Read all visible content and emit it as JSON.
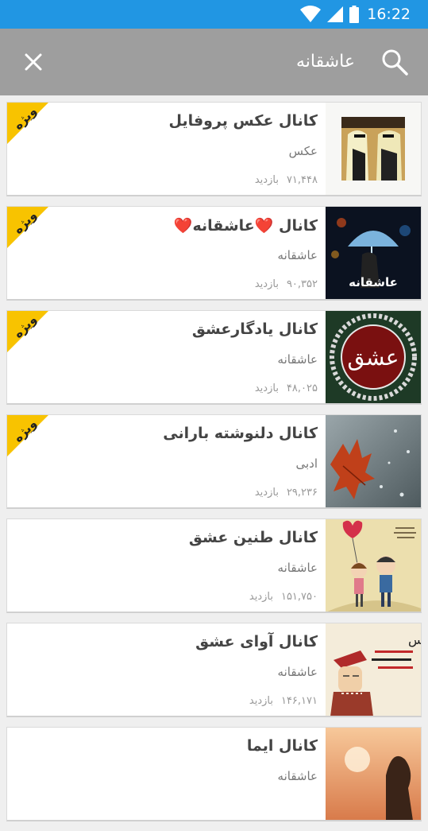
{
  "status_bar": {
    "time": "16:22"
  },
  "search": {
    "query": "عاشقانه"
  },
  "badge_label": "ویژه",
  "views_label": "بازدید",
  "channels": [
    {
      "title": "کانال عکس پروفایل",
      "category": "عکس",
      "views": "۷۱,۴۴۸",
      "featured": true
    },
    {
      "title": "کانال ❤️عاشقانه❤️",
      "category": "عاشقانه",
      "views": "۹۰,۳۵۲",
      "featured": true
    },
    {
      "title": "کانال یادگارعشق",
      "category": "عاشقانه",
      "views": "۴۸,۰۲۵",
      "featured": true
    },
    {
      "title": "کانال دلنوشته بارانی",
      "category": "ادبی",
      "views": "۲۹,۲۳۶",
      "featured": true
    },
    {
      "title": "کانال طنین عشق",
      "category": "عاشقانه",
      "views": "۱۵۱,۷۵۰",
      "featured": false
    },
    {
      "title": "کانال آوای عشق",
      "category": "عاشقانه",
      "views": "۱۴۶,۱۷۱",
      "featured": false
    },
    {
      "title": "کانال ایما",
      "category": "عاشقانه",
      "views": "",
      "featured": false
    }
  ],
  "thumb_texts": {
    "ashegh": "عاشقانه",
    "eshgh": "عشق",
    "hichkas": "هیچکس"
  },
  "colors": {
    "status_bar": "#2196e3",
    "search_bar": "#9e9e9e",
    "badge": "#f8c300"
  }
}
